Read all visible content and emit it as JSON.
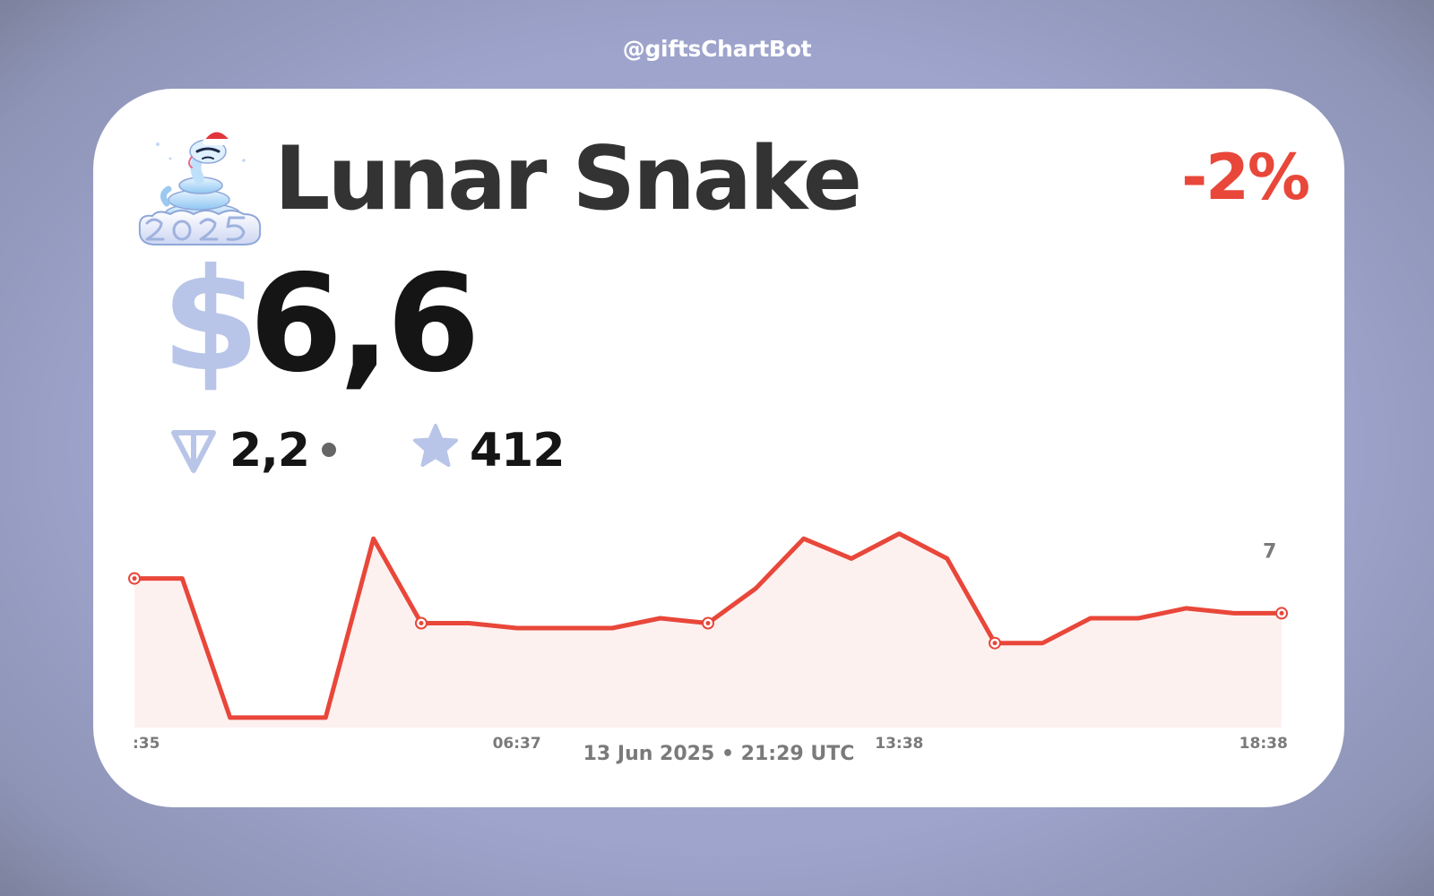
{
  "handle": "@giftsChartBot",
  "gift": {
    "name": "Lunar Snake",
    "icon": "snake-2025-icon",
    "change": "-2%",
    "usd_symbol": "$",
    "usd_price": "6,6",
    "ton_price": "2,2",
    "stars_price": "412"
  },
  "colors": {
    "accent": "#e8473a",
    "usd_symbol": "#b8c5e8",
    "icons": "#b8c5e8",
    "title": "#333333",
    "background": "#9ea4cc"
  },
  "chart_data": {
    "type": "area",
    "x": [
      "",
      "",
      "",
      "",
      "",
      "",
      "",
      "",
      "",
      "",
      "",
      "",
      "",
      "",
      "",
      "",
      "",
      "",
      "",
      "",
      "",
      "",
      "",
      "",
      ""
    ],
    "values": [
      6.68,
      6.68,
      6.4,
      6.4,
      6.4,
      6.76,
      6.59,
      6.59,
      6.58,
      6.58,
      6.58,
      6.6,
      6.59,
      6.66,
      6.76,
      6.72,
      6.77,
      6.72,
      6.55,
      6.55,
      6.6,
      6.6,
      6.62,
      6.61,
      6.61
    ],
    "markers": [
      0,
      6,
      12,
      18,
      24
    ],
    "tick_labels": [
      {
        "index": 0,
        "label": ":35"
      },
      {
        "index": 8,
        "label": "06:37"
      },
      {
        "index": 16,
        "label": "13:38"
      },
      {
        "index": 23,
        "label": "18:38"
      }
    ],
    "y_axis_label": "7",
    "y_axis_value": 6.75,
    "ylim": [
      6.38,
      6.8
    ],
    "line_color": "#e8473a",
    "fill_color": "#fdf1f0",
    "grid": false
  },
  "footer": "13 Jun 2025 • 21:29 UTC"
}
